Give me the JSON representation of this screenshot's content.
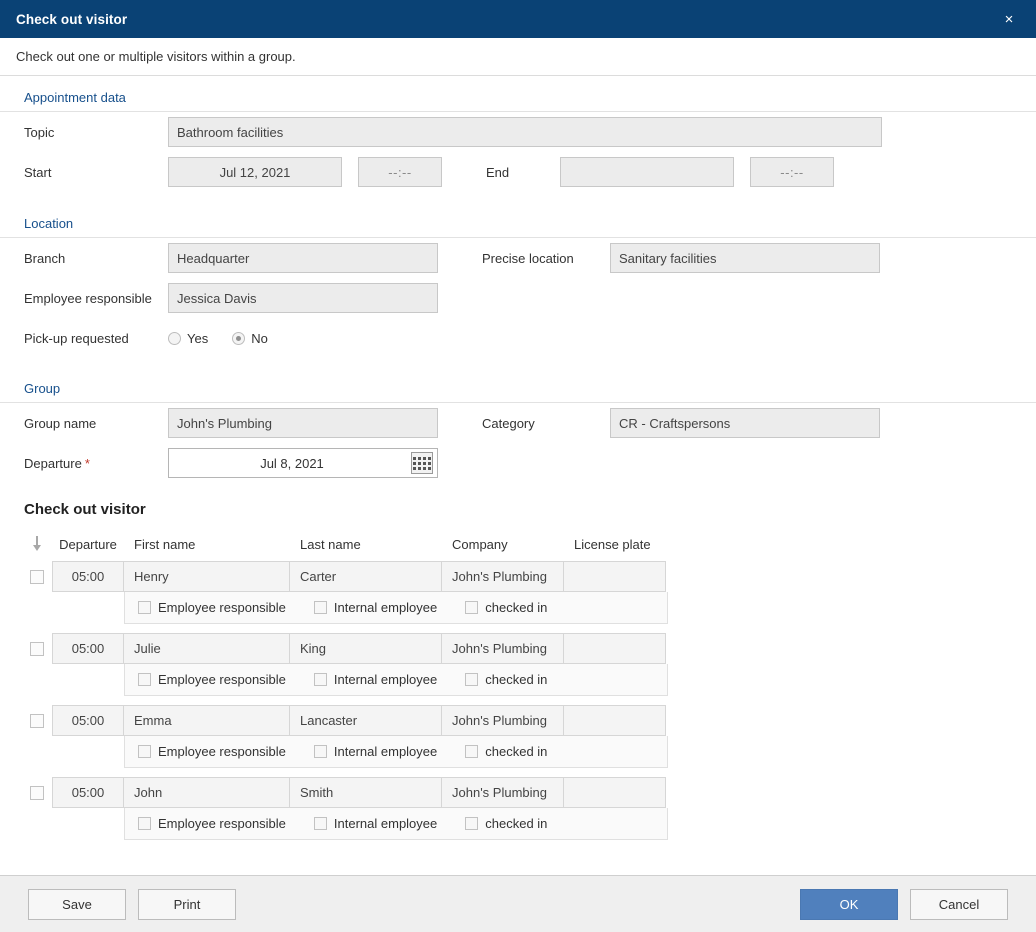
{
  "window": {
    "title": "Check out visitor",
    "close_label": "×",
    "subtitle": "Check out one or multiple visitors within a group."
  },
  "sections": {
    "appointment": {
      "heading": "Appointment data",
      "topic_label": "Topic",
      "topic_value": "Bathroom facilities",
      "start_label": "Start",
      "start_date": "Jul 12, 2021",
      "start_time": "--:--",
      "end_label": "End",
      "end_date": "",
      "end_time": "--:--"
    },
    "location": {
      "heading": "Location",
      "branch_label": "Branch",
      "branch_value": "Headquarter",
      "precise_label": "Precise location",
      "precise_value": "Sanitary facilities",
      "employee_label": "Employee responsible",
      "employee_value": "Jessica Davis",
      "pickup_label": "Pick-up requested",
      "pickup_yes": "Yes",
      "pickup_no": "No",
      "pickup_selected": "No"
    },
    "group": {
      "heading": "Group",
      "group_name_label": "Group name",
      "group_name_value": "John's Plumbing",
      "category_label": "Category",
      "category_value": "CR - Craftspersons",
      "departure_label": "Departure",
      "departure_required_marker": "*",
      "departure_value": "Jul 8, 2021",
      "calendar_icon": "calendar-icon"
    }
  },
  "visitor_table": {
    "title": "Check out visitor",
    "sort_icon": "sort-descending-arrow-icon",
    "columns": {
      "departure": "Departure",
      "first_name": "First name",
      "last_name": "Last name",
      "company": "Company",
      "license_plate": "License plate"
    },
    "sub_labels": {
      "employee_responsible": "Employee responsible",
      "internal_employee": "Internal employee",
      "checked_in": "checked in"
    },
    "rows": [
      {
        "selected": false,
        "departure": "05:00",
        "first_name": "Henry",
        "last_name": "Carter",
        "company": "John's Plumbing",
        "license_plate": "",
        "employee_responsible": false,
        "internal_employee": false,
        "checked_in": false
      },
      {
        "selected": false,
        "departure": "05:00",
        "first_name": "Julie",
        "last_name": "King",
        "company": "John's Plumbing",
        "license_plate": "",
        "employee_responsible": false,
        "internal_employee": false,
        "checked_in": false
      },
      {
        "selected": false,
        "departure": "05:00",
        "first_name": "Emma",
        "last_name": "Lancaster",
        "company": "John's Plumbing",
        "license_plate": "",
        "employee_responsible": false,
        "internal_employee": false,
        "checked_in": false
      },
      {
        "selected": false,
        "departure": "05:00",
        "first_name": "John",
        "last_name": "Smith",
        "company": "John's Plumbing",
        "license_plate": "",
        "employee_responsible": false,
        "internal_employee": false,
        "checked_in": false
      }
    ]
  },
  "footer": {
    "save": "Save",
    "print": "Print",
    "ok": "OK",
    "cancel": "Cancel"
  },
  "colors": {
    "titlebar": "#0a4275",
    "section_heading": "#17508c",
    "primary_button": "#5080bd",
    "required_star": "#c0392b"
  }
}
